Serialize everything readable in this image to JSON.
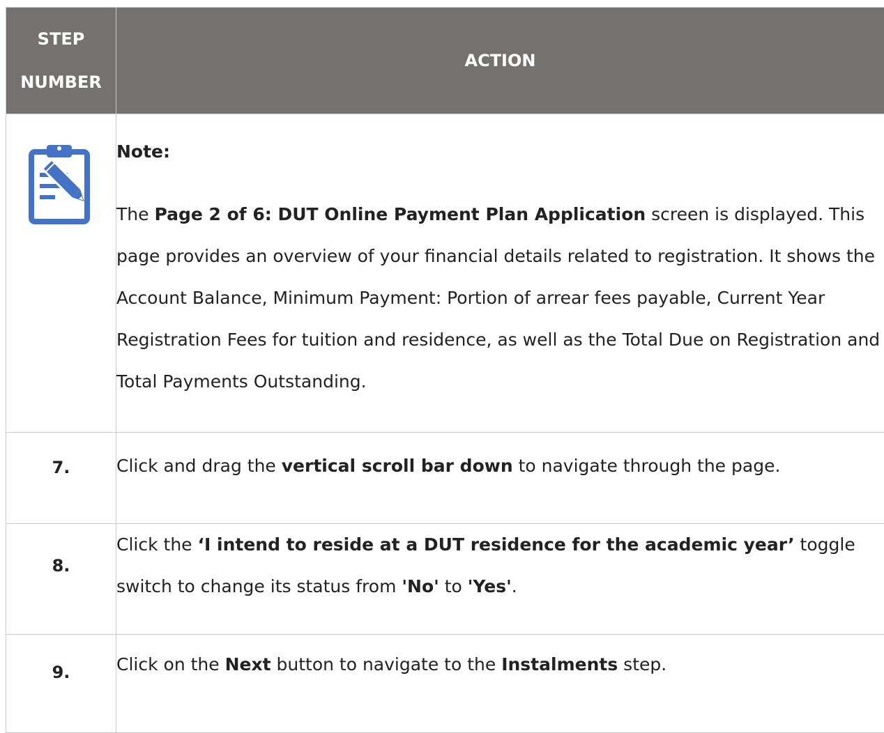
{
  "header": {
    "step_line1": "STEP",
    "step_line2": "NUMBER",
    "action": "ACTION"
  },
  "note": {
    "icon": "clipboard-edit-icon",
    "title": "Note:",
    "body_prefix": "The ",
    "body_bold": "Page 2 of 6: DUT Online Payment Plan Application",
    "body_suffix": " screen is displayed. This page provides an overview of your financial details related to registration. It shows the Account Balance, Minimum Payment: Portion of arrear fees payable, Current Year Registration Fees for tuition and residence, as well as the Total Due on Registration and Total Payments Outstanding."
  },
  "steps": [
    {
      "number": "7.",
      "text": [
        {
          "t": "Click and drag the ",
          "b": false
        },
        {
          "t": "vertical scroll bar down",
          "b": true
        },
        {
          "t": " to navigate through the page.",
          "b": false
        }
      ]
    },
    {
      "number": "8.",
      "text": [
        {
          "t": "Click the ",
          "b": false
        },
        {
          "t": "‘I intend to reside at a DUT residence for the academic year’",
          "b": true
        },
        {
          "t": " toggle switch to change its status from ",
          "b": false
        },
        {
          "t": "'No'",
          "b": true
        },
        {
          "t": " to ",
          "b": false
        },
        {
          "t": "'Yes'",
          "b": true
        },
        {
          "t": ".",
          "b": false
        }
      ]
    },
    {
      "number": "9.",
      "text": [
        {
          "t": "Click on the ",
          "b": false
        },
        {
          "t": "Next",
          "b": true
        },
        {
          "t": " button to navigate to the ",
          "b": false
        },
        {
          "t": "Instalments",
          "b": true
        },
        {
          "t": " step.",
          "b": false
        }
      ]
    }
  ],
  "colors": {
    "header_bg": "#767171",
    "icon_blue": "#4472c4"
  }
}
